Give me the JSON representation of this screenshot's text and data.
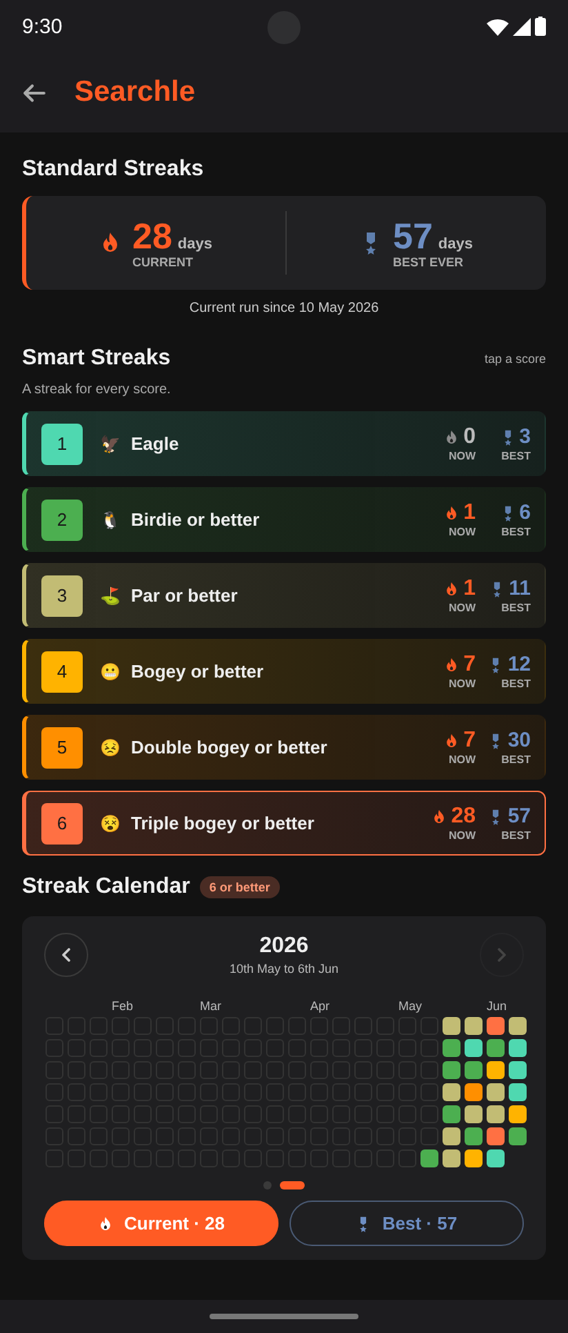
{
  "status_bar": {
    "time": "9:30"
  },
  "app_bar": {
    "title": "Searchle"
  },
  "standard": {
    "title": "Standard Streaks",
    "current": {
      "value": "28",
      "unit": "days",
      "label": "CURRENT"
    },
    "best": {
      "value": "57",
      "unit": "days",
      "label": "BEST EVER"
    },
    "note": "Current run since 10 May 2026"
  },
  "smart": {
    "title": "Smart Streaks",
    "hint": "tap a score",
    "subtitle": "A streak for every score.",
    "rows": [
      {
        "number": "1",
        "emoji": "🦅",
        "name": "Eagle",
        "now": "0",
        "now_label": "NOW",
        "best": "3",
        "best_label": "BEST",
        "color": "#4fd8b0",
        "active": false,
        "selected": false
      },
      {
        "number": "2",
        "emoji": "🐧",
        "name": "Birdie or better",
        "now": "1",
        "now_label": "NOW",
        "best": "6",
        "best_label": "BEST",
        "color": "#4caf50",
        "active": true,
        "selected": false
      },
      {
        "number": "3",
        "emoji": "⛳",
        "name": "Par or better",
        "now": "1",
        "now_label": "NOW",
        "best": "11",
        "best_label": "BEST",
        "color": "#c2bc74",
        "active": true,
        "selected": false
      },
      {
        "number": "4",
        "emoji": "😬",
        "name": "Bogey or better",
        "now": "7",
        "now_label": "NOW",
        "best": "12",
        "best_label": "BEST",
        "color": "#ffb300",
        "active": true,
        "selected": false
      },
      {
        "number": "5",
        "emoji": "😣",
        "name": "Double bogey or better",
        "now": "7",
        "now_label": "NOW",
        "best": "30",
        "best_label": "BEST",
        "color": "#ff8f00",
        "active": true,
        "selected": false
      },
      {
        "number": "6",
        "emoji": "😵",
        "name": "Triple bogey or better",
        "now": "28",
        "now_label": "NOW",
        "best": "57",
        "best_label": "BEST",
        "color": "#ff7043",
        "active": true,
        "selected": true
      }
    ]
  },
  "calendar": {
    "title": "Streak Calendar",
    "badge": "6 or better",
    "year": "2026",
    "range": "10th May to 6th Jun",
    "weeks": [
      {
        "days": [
          {
            "kind": "empty"
          },
          {
            "kind": "empty"
          },
          {
            "kind": "empty"
          },
          {
            "kind": "empty"
          },
          {
            "kind": "empty"
          },
          {
            "kind": "empty"
          },
          {
            "kind": "empty"
          }
        ]
      },
      {
        "days": [
          {
            "kind": "empty"
          },
          {
            "kind": "empty"
          },
          {
            "kind": "empty"
          },
          {
            "kind": "empty"
          },
          {
            "kind": "empty"
          },
          {
            "kind": "empty"
          },
          {
            "kind": "empty"
          }
        ]
      },
      {
        "days": [
          {
            "kind": "empty"
          },
          {
            "kind": "empty"
          },
          {
            "kind": "empty"
          },
          {
            "kind": "empty"
          },
          {
            "kind": "empty"
          },
          {
            "kind": "empty"
          },
          {
            "kind": "empty"
          }
        ]
      },
      {
        "month": "Feb",
        "days": [
          {
            "kind": "empty"
          },
          {
            "kind": "empty"
          },
          {
            "kind": "empty"
          },
          {
            "kind": "empty"
          },
          {
            "kind": "empty"
          },
          {
            "kind": "empty"
          },
          {
            "kind": "empty"
          }
        ]
      },
      {
        "days": [
          {
            "kind": "empty"
          },
          {
            "kind": "empty"
          },
          {
            "kind": "empty"
          },
          {
            "kind": "empty"
          },
          {
            "kind": "empty"
          },
          {
            "kind": "empty"
          },
          {
            "kind": "empty"
          }
        ]
      },
      {
        "days": [
          {
            "kind": "empty"
          },
          {
            "kind": "empty"
          },
          {
            "kind": "empty"
          },
          {
            "kind": "empty"
          },
          {
            "kind": "empty"
          },
          {
            "kind": "empty"
          },
          {
            "kind": "empty"
          }
        ]
      },
      {
        "days": [
          {
            "kind": "empty"
          },
          {
            "kind": "empty"
          },
          {
            "kind": "empty"
          },
          {
            "kind": "empty"
          },
          {
            "kind": "empty"
          },
          {
            "kind": "empty"
          },
          {
            "kind": "empty"
          }
        ]
      },
      {
        "month": "Mar",
        "days": [
          {
            "kind": "empty"
          },
          {
            "kind": "empty"
          },
          {
            "kind": "empty"
          },
          {
            "kind": "empty"
          },
          {
            "kind": "empty"
          },
          {
            "kind": "empty"
          },
          {
            "kind": "empty"
          }
        ]
      },
      {
        "days": [
          {
            "kind": "empty"
          },
          {
            "kind": "empty"
          },
          {
            "kind": "empty"
          },
          {
            "kind": "empty"
          },
          {
            "kind": "empty"
          },
          {
            "kind": "empty"
          },
          {
            "kind": "empty"
          }
        ]
      },
      {
        "days": [
          {
            "kind": "empty"
          },
          {
            "kind": "empty"
          },
          {
            "kind": "empty"
          },
          {
            "kind": "empty"
          },
          {
            "kind": "empty"
          },
          {
            "kind": "empty"
          },
          {
            "kind": "empty"
          }
        ]
      },
      {
        "days": [
          {
            "kind": "empty"
          },
          {
            "kind": "empty"
          },
          {
            "kind": "empty"
          },
          {
            "kind": "empty"
          },
          {
            "kind": "empty"
          },
          {
            "kind": "empty"
          },
          {
            "kind": "empty"
          }
        ]
      },
      {
        "days": [
          {
            "kind": "empty"
          },
          {
            "kind": "empty"
          },
          {
            "kind": "empty"
          },
          {
            "kind": "empty"
          },
          {
            "kind": "empty"
          },
          {
            "kind": "empty"
          },
          {
            "kind": "empty"
          }
        ]
      },
      {
        "month": "Apr",
        "days": [
          {
            "kind": "empty"
          },
          {
            "kind": "empty"
          },
          {
            "kind": "empty"
          },
          {
            "kind": "empty"
          },
          {
            "kind": "empty"
          },
          {
            "kind": "empty"
          },
          {
            "kind": "empty"
          }
        ]
      },
      {
        "days": [
          {
            "kind": "empty"
          },
          {
            "kind": "empty"
          },
          {
            "kind": "empty"
          },
          {
            "kind": "empty"
          },
          {
            "kind": "empty"
          },
          {
            "kind": "empty"
          },
          {
            "kind": "empty"
          }
        ]
      },
      {
        "days": [
          {
            "kind": "empty"
          },
          {
            "kind": "empty"
          },
          {
            "kind": "empty"
          },
          {
            "kind": "empty"
          },
          {
            "kind": "empty"
          },
          {
            "kind": "empty"
          },
          {
            "kind": "empty"
          }
        ]
      },
      {
        "days": [
          {
            "kind": "empty"
          },
          {
            "kind": "empty"
          },
          {
            "kind": "empty"
          },
          {
            "kind": "empty"
          },
          {
            "kind": "empty"
          },
          {
            "kind": "empty"
          },
          {
            "kind": "empty"
          }
        ]
      },
      {
        "month": "May",
        "days": [
          {
            "kind": "empty"
          },
          {
            "kind": "empty"
          },
          {
            "kind": "empty"
          },
          {
            "kind": "empty"
          },
          {
            "kind": "empty"
          },
          {
            "kind": "empty"
          },
          {
            "kind": "empty"
          }
        ]
      },
      {
        "days": [
          {
            "kind": "empty"
          },
          {
            "kind": "empty"
          },
          {
            "kind": "empty"
          },
          {
            "kind": "empty"
          },
          {
            "kind": "empty"
          },
          {
            "kind": "empty"
          },
          {
            "kind": "played",
            "color": "#4caf50"
          }
        ]
      },
      {
        "days": [
          {
            "kind": "played",
            "color": "#c2bc74"
          },
          {
            "kind": "played",
            "color": "#4caf50"
          },
          {
            "kind": "played",
            "color": "#4caf50"
          },
          {
            "kind": "played",
            "color": "#c2bc74"
          },
          {
            "kind": "played",
            "color": "#4caf50"
          },
          {
            "kind": "played",
            "color": "#c2bc74"
          },
          {
            "kind": "played",
            "color": "#c2bc74"
          }
        ]
      },
      {
        "days": [
          {
            "kind": "played",
            "color": "#c2bc74"
          },
          {
            "kind": "played",
            "color": "#4fd8b0"
          },
          {
            "kind": "played",
            "color": "#4caf50"
          },
          {
            "kind": "played",
            "color": "#ff8f00"
          },
          {
            "kind": "played",
            "color": "#c2bc74"
          },
          {
            "kind": "played",
            "color": "#4caf50"
          },
          {
            "kind": "played",
            "color": "#ffb300"
          }
        ]
      },
      {
        "month": "Jun",
        "days": [
          {
            "kind": "played",
            "color": "#ff7043"
          },
          {
            "kind": "played",
            "color": "#4caf50"
          },
          {
            "kind": "played",
            "color": "#ffb300"
          },
          {
            "kind": "played",
            "color": "#c2bc74"
          },
          {
            "kind": "played",
            "color": "#c2bc74"
          },
          {
            "kind": "played",
            "color": "#ff7043"
          },
          {
            "kind": "played",
            "color": "#4fd8b0"
          }
        ]
      },
      {
        "days": [
          {
            "kind": "played",
            "color": "#c2bc74"
          },
          {
            "kind": "played",
            "color": "#4fd8b0"
          },
          {
            "kind": "played",
            "color": "#4fd8b0"
          },
          {
            "kind": "played",
            "color": "#4fd8b0"
          },
          {
            "kind": "played",
            "color": "#ffb300"
          },
          {
            "kind": "played",
            "color": "#4caf50"
          }
        ]
      }
    ],
    "pages": [
      {
        "selected": false
      },
      {
        "selected": true
      }
    ],
    "toggles": [
      {
        "kind": "current",
        "label": "Current · 28",
        "selected": true
      },
      {
        "kind": "best",
        "label": "Best · 57",
        "selected": false
      }
    ]
  }
}
